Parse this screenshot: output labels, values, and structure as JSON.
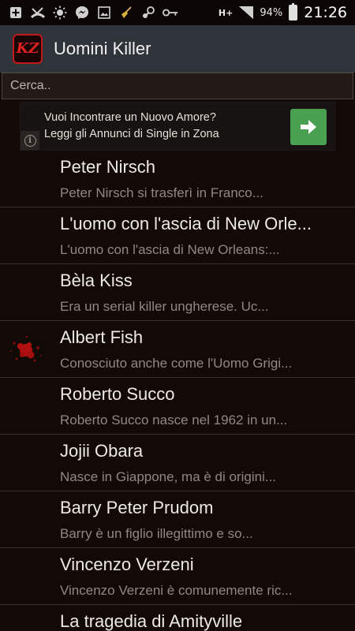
{
  "status_bar": {
    "battery": "94%",
    "time": "21:26",
    "network": "H+",
    "icons": [
      "add-icon",
      "missed-call-icon",
      "brightness-icon",
      "messenger-icon",
      "image-icon",
      "broom-icon",
      "steam-icon",
      "key-icon"
    ]
  },
  "app": {
    "title": "Uomini Killer",
    "logo_text": "KZ"
  },
  "search": {
    "placeholder": "Cerca.."
  },
  "ad": {
    "line1": "Vuoi Incontrare un Nuovo Amore?",
    "line2": "Leggi gli Annunci di Single in Zona",
    "arrow_color": "#48a050"
  },
  "list": [
    {
      "title": "Peter Nirsch",
      "subtitle": "Peter Nirsch si trasferì in Franco..."
    },
    {
      "title": "L'uomo con l'ascia di New Orle...",
      "subtitle": "L'uomo con l'ascia di New Orleans:..."
    },
    {
      "title": "Bèla Kiss",
      "subtitle": "Era un serial killer ungherese. Uc..."
    },
    {
      "title": "Albert Fish",
      "subtitle": "Conosciuto anche come l'Uomo Grigi..."
    },
    {
      "title": "Roberto Succo",
      "subtitle": "Roberto Succo nasce nel 1962 in un..."
    },
    {
      "title": "Jojii Obara",
      "subtitle": "Nasce in Giappone, ma è di origini..."
    },
    {
      "title": "Barry Peter Prudom",
      "subtitle": "Barry è un figlio illegittimo e so..."
    },
    {
      "title": "Vincenzo Verzeni",
      "subtitle": "Vincenzo Verzeni è comunemente ric..."
    },
    {
      "title": "La tragedia di Amityville",
      "subtitle": ""
    }
  ],
  "colors": {
    "background": "#120a06",
    "action_bar": "#2f343a",
    "blood": "#b01010"
  }
}
